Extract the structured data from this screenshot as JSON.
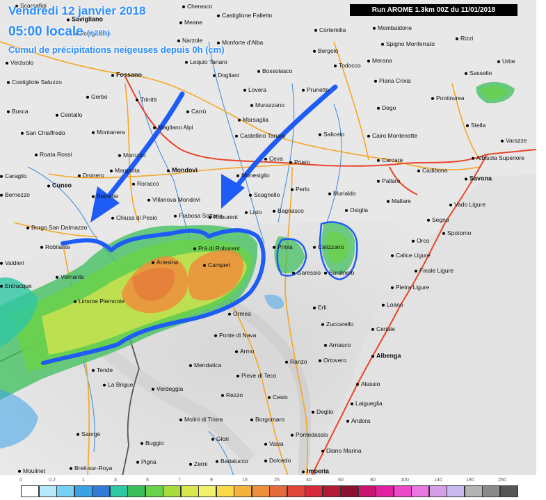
{
  "header": {
    "date": "Vendredi 12 janvier 2018",
    "time": "05:00 locale",
    "time_offset": "(+28h)",
    "subtitle": "Cumul de précipitations neigeuses depuis 0h (cm)",
    "run": "Run AROME 1.3km 00Z du 11/01/2018"
  },
  "colors": {
    "accent_text": "#2a8cff",
    "arrow": "#1f5cf5",
    "outline": "#1f5cf5",
    "roads": "#f5a623",
    "highways": "#e8452a",
    "rivers": "#4a90d9",
    "border": "#555555"
  },
  "towns": [
    {
      "name": "Scarnafigi"
    },
    {
      "name": "Savigliano"
    },
    {
      "name": "Vottignasco"
    },
    {
      "name": "Verzuolo"
    },
    {
      "name": "Costigliole Saluzzo"
    },
    {
      "name": "Fossano"
    },
    {
      "name": "Gerbo"
    },
    {
      "name": "Trinità"
    },
    {
      "name": "Busca"
    },
    {
      "name": "Centallo"
    },
    {
      "name": "San Chiaffredo"
    },
    {
      "name": "Montanera"
    },
    {
      "name": "Roata Rossi"
    },
    {
      "name": "Morozzo"
    },
    {
      "name": "Margarita"
    },
    {
      "name": "Dronero"
    },
    {
      "name": "Caraglio"
    },
    {
      "name": "Cuneo"
    },
    {
      "name": "Bernezzo"
    },
    {
      "name": "Beinette"
    },
    {
      "name": "Roracco"
    },
    {
      "name": "Villanova Mondovi"
    },
    {
      "name": "Mondovì"
    },
    {
      "name": "Carrù"
    },
    {
      "name": "Magliano Alpi"
    },
    {
      "name": "Narzole"
    },
    {
      "name": "Meane"
    },
    {
      "name": "Cherasco"
    },
    {
      "name": "Lequio Tanaro"
    },
    {
      "name": "Monforte d'Alba"
    },
    {
      "name": "Castiglione Falletto"
    },
    {
      "name": "Dogliani"
    },
    {
      "name": "Lovera"
    },
    {
      "name": "Bossolasco"
    },
    {
      "name": "Murazzano"
    },
    {
      "name": "Marsaglia"
    },
    {
      "name": "Castellino Tanaro"
    },
    {
      "name": "Ceva"
    },
    {
      "name": "Priero"
    },
    {
      "name": "Monesiglio"
    },
    {
      "name": "Prunetto"
    },
    {
      "name": "Saliceto"
    },
    {
      "name": "Bergolo"
    },
    {
      "name": "Cortemilia"
    },
    {
      "name": "Todocco"
    },
    {
      "name": "Merana"
    },
    {
      "name": "Mombaldone"
    },
    {
      "name": "Spigno Monferrato"
    },
    {
      "name": "Rizzi"
    },
    {
      "name": "Piana Crixia"
    },
    {
      "name": "Dego"
    },
    {
      "name": "Cairo Montenotte"
    },
    {
      "name": "Sassello"
    },
    {
      "name": "Urbe"
    },
    {
      "name": "Pontinvrea"
    },
    {
      "name": "Stella"
    },
    {
      "name": "Varazze"
    },
    {
      "name": "Albisola Superiore"
    },
    {
      "name": "Savona"
    },
    {
      "name": "Cadibona"
    },
    {
      "name": "Carcare"
    },
    {
      "name": "Pallare"
    },
    {
      "name": "Mallare"
    },
    {
      "name": "Vado Ligure"
    },
    {
      "name": "Segno"
    },
    {
      "name": "Spotorno"
    },
    {
      "name": "Orco"
    },
    {
      "name": "Calice Ligure"
    },
    {
      "name": "Finale Ligure"
    },
    {
      "name": "Pietra Ligure"
    },
    {
      "name": "Loano"
    },
    {
      "name": "Ceriale"
    },
    {
      "name": "Albenga"
    },
    {
      "name": "Alassio"
    },
    {
      "name": "Laigueglia"
    },
    {
      "name": "Andora"
    },
    {
      "name": "Diano Marina"
    },
    {
      "name": "Imperia"
    },
    {
      "name": "Osiglia"
    },
    {
      "name": "Murialdo"
    },
    {
      "name": "Perlo"
    },
    {
      "name": "Scagnello"
    },
    {
      "name": "Lisio"
    },
    {
      "name": "Bagnasco"
    },
    {
      "name": "Roburent"
    },
    {
      "name": "Frabosa Sottana"
    },
    {
      "name": "Chiusa di Pesio"
    },
    {
      "name": "Borgo San Dalmazzo"
    },
    {
      "name": "Robilante"
    },
    {
      "name": "Valdieri"
    },
    {
      "name": "Vernante"
    },
    {
      "name": "Entracque"
    },
    {
      "name": "Limone Piemonte"
    },
    {
      "name": "Artesina"
    },
    {
      "name": "Camperi"
    },
    {
      "name": "Prà di Roburent"
    },
    {
      "name": "Priola"
    },
    {
      "name": "Garessio"
    },
    {
      "name": "Calizzano"
    },
    {
      "name": "Bardineto"
    },
    {
      "name": "Ormea"
    },
    {
      "name": "Erli"
    },
    {
      "name": "Zuccarello"
    },
    {
      "name": "Arnasco"
    },
    {
      "name": "Ortovero"
    },
    {
      "name": "Ranzo"
    },
    {
      "name": "Armo"
    },
    {
      "name": "Ponte di Nava"
    },
    {
      "name": "Mendatica"
    },
    {
      "name": "Pieve di Teco"
    },
    {
      "name": "Tende"
    },
    {
      "name": "La Brigue"
    },
    {
      "name": "Verdeggia"
    },
    {
      "name": "Rezzo"
    },
    {
      "name": "Cesio"
    },
    {
      "name": "Borgomaro"
    },
    {
      "name": "Molini di Triora"
    },
    {
      "name": "Pontedassio"
    },
    {
      "name": "Deglio"
    },
    {
      "name": "Glori"
    },
    {
      "name": "Vasia"
    },
    {
      "name": "Saorge"
    },
    {
      "name": "Buggio"
    },
    {
      "name": "Badalucco"
    },
    {
      "name": "Dolcedo"
    },
    {
      "name": "Pigna"
    },
    {
      "name": "Zerni"
    },
    {
      "name": "Breil-sur-Roya"
    },
    {
      "name": "Moulinet"
    }
  ],
  "legend": {
    "labels": [
      "0",
      "0.2",
      "1",
      "3",
      "5",
      "7",
      "9",
      "15",
      "25",
      "40",
      "60",
      "80",
      "100",
      "140",
      "180",
      "250"
    ],
    "colors": [
      "#ffffff",
      "#b8e8fb",
      "#7ad1f7",
      "#3aa0e8",
      "#2f7bd6",
      "#2fc7a4",
      "#3bbf5a",
      "#6ad14a",
      "#a6dc3c",
      "#d9e650",
      "#f2f06c",
      "#f7d94a",
      "#f5b23d",
      "#ef8e3b",
      "#e66b3b",
      "#e0453a",
      "#d82a3d",
      "#b51a35",
      "#8c1030",
      "#c8146e",
      "#e022a0",
      "#ec49c8",
      "#e977e2",
      "#d69ee8",
      "#c7b8ee",
      "#b3b3b3",
      "#8a8a8a",
      "#555555"
    ]
  }
}
